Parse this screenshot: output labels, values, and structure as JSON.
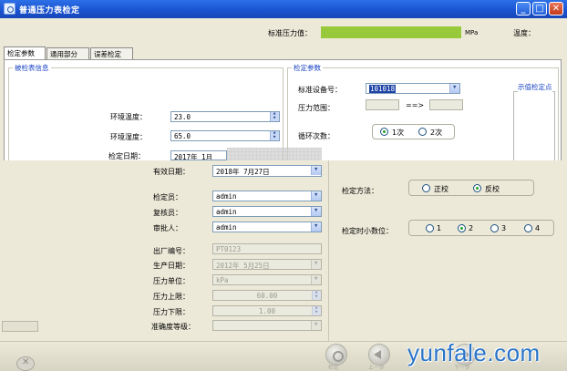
{
  "window": {
    "title": "普通压力表检定",
    "buttons": [
      "_",
      "□",
      "✕"
    ]
  },
  "header": {
    "standard_pressure_label": "标准压力值：",
    "unit": "MPa",
    "temperature_label": "温度：",
    "gauge_color": "#98c93a"
  },
  "tabs": [
    {
      "label": "检定参数",
      "active": true
    },
    {
      "label": "通用部分",
      "active": false
    },
    {
      "label": "误差检定",
      "active": false
    }
  ],
  "inspected_group": {
    "title": "被检表信息",
    "ambient_temp_label": "环境温度：",
    "ambient_temp_value": "23.0",
    "ambient_humidity_label": "环境湿度：",
    "ambient_humidity_value": "65.0",
    "test_date_label": "检定日期：",
    "test_date_value": "2017年 1月",
    "valid_date_label": "有效日期：",
    "valid_date_value": "2018年 7月27日",
    "inspector_label": "检定员：",
    "inspector_value": "admin",
    "reviewer_label": "复核员：",
    "reviewer_value": "admin",
    "approver_label": "审批人：",
    "approver_value": "admin",
    "serial_label": "出厂编号：",
    "serial_value": "PT0123",
    "production_date_label": "生产日期：",
    "production_date_value": "2012年 5月25日",
    "pressure_unit_label": "压力单位：",
    "pressure_unit_value": "kPa",
    "upper_limit_label": "压力上限：",
    "upper_limit_value": "60.00",
    "lower_limit_label": "压力下限：",
    "lower_limit_value": "1.00",
    "accuracy_label": "准确度等级："
  },
  "params_group": {
    "title": "检定参数",
    "std_device_label": "标准设备号：",
    "std_device_value": "101018",
    "pressure_range_label": "压力范围：",
    "range_arrow": "==>",
    "cycles_label": "循环次数：",
    "cycles_options": [
      "1次",
      "2次"
    ],
    "cycles_selected": 0,
    "method_label": "检定方法：",
    "method_options": [
      "正校",
      "反校"
    ],
    "method_selected": 1,
    "decimals_label": "检定时小数位：",
    "decimals_options": [
      "1",
      "2",
      "3",
      "4"
    ],
    "decimals_selected": 1
  },
  "side_panel": {
    "title": "示值检定点"
  },
  "bottom_nav": {
    "labels": [
      "检定",
      "上一步",
      "下一步"
    ]
  },
  "watermark": "yunfale.com"
}
